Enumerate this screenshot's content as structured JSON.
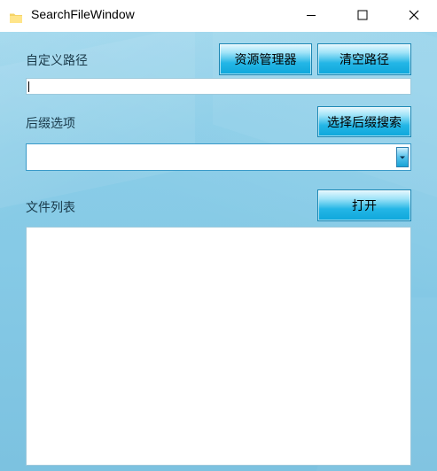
{
  "window": {
    "title": "SearchFileWindow"
  },
  "path_section": {
    "label": "自定义路径",
    "explorer_button": "资源管理器",
    "clear_button": "清空路径",
    "path_value": ""
  },
  "suffix_section": {
    "label": "后缀选项",
    "search_button": "选择后缀搜索",
    "selected_value": ""
  },
  "file_section": {
    "label": "文件列表",
    "open_button": "打开",
    "items": []
  },
  "colors": {
    "background": "#86cae6",
    "button_gradient_end": "#0ea7db",
    "button_border": "#1b86b3"
  }
}
